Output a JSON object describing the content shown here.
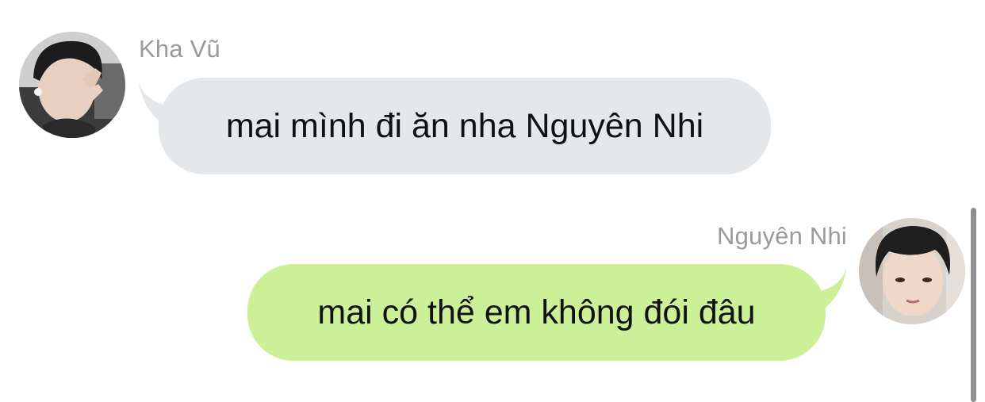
{
  "messages": [
    {
      "sender": "Kha Vũ",
      "text": "mai mình đi ăn nha Nguyên Nhi",
      "side": "left",
      "bubble_color": "#e4e8eb"
    },
    {
      "sender": "Nguyên Nhi",
      "text": "mai có thể em không đói đâu",
      "side": "right",
      "bubble_color": "#ccf098"
    }
  ],
  "colors": {
    "background": "#ffffff",
    "sender_name": "#9a9a9a",
    "message_text": "#111111",
    "scrollbar": "#8e8e93"
  }
}
